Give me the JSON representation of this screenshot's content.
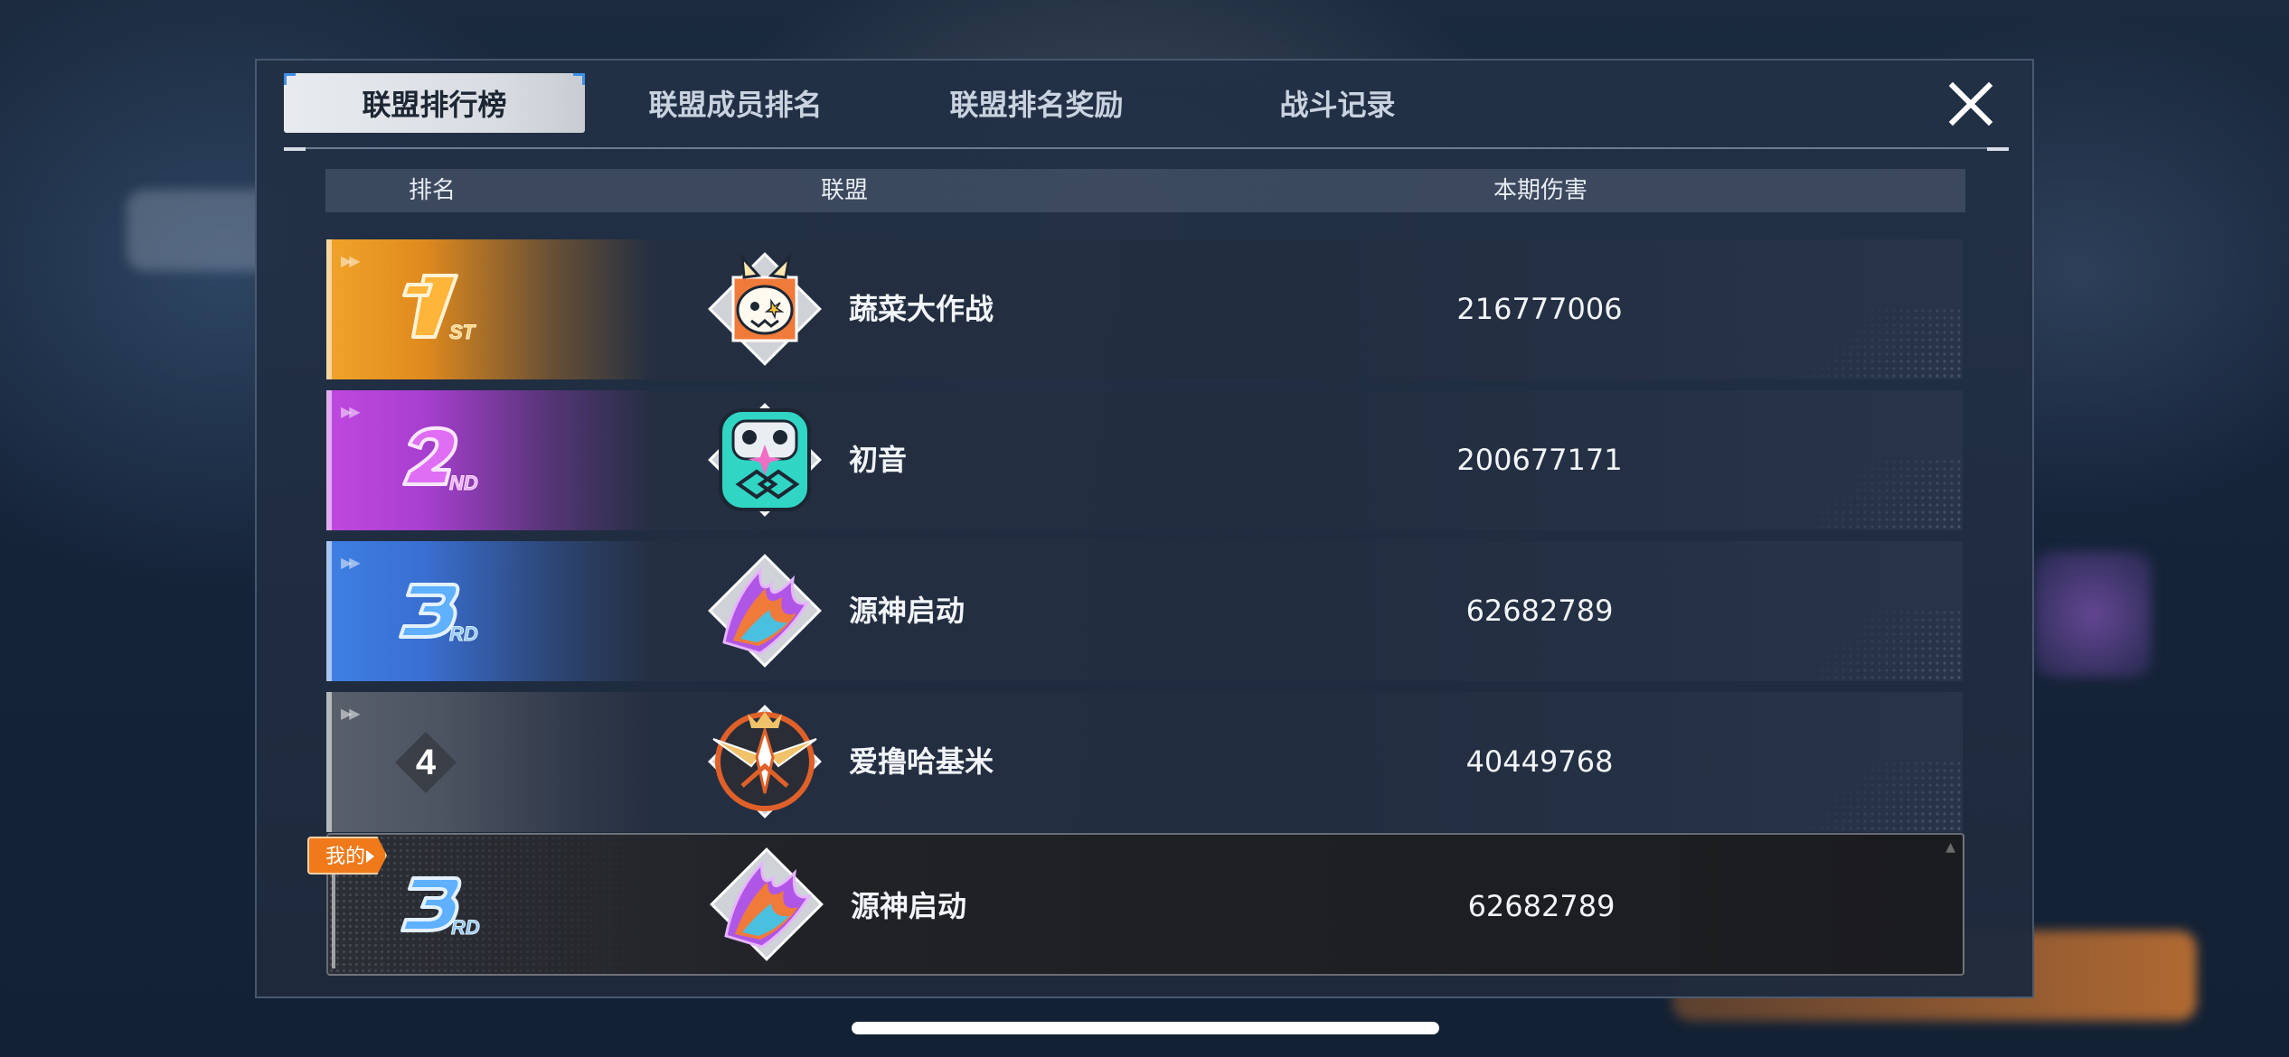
{
  "tabs": [
    {
      "label": "联盟排行榜",
      "active": true
    },
    {
      "label": "联盟成员排名",
      "active": false
    },
    {
      "label": "联盟排名奖励",
      "active": false
    },
    {
      "label": "战斗记录",
      "active": false
    }
  ],
  "columns": {
    "rank": "排名",
    "alliance": "联盟",
    "damage": "本期伤害"
  },
  "rows": [
    {
      "rank": 1,
      "rank_suffix": "ST",
      "rank_color": "#f0a42a",
      "name": "蔬菜大作战",
      "damage": "216777006",
      "emblem": "rabbit-emblem-icon"
    },
    {
      "rank": 2,
      "rank_suffix": "ND",
      "rank_color": "#c148e0",
      "name": "初音",
      "damage": "200677171",
      "emblem": "robot-emblem-icon"
    },
    {
      "rank": 3,
      "rank_suffix": "RD",
      "rank_color": "#3e7fe4",
      "name": "源神启动",
      "damage": "62682789",
      "emblem": "flame-emblem-icon"
    },
    {
      "rank": 4,
      "rank_label": "4",
      "rank_color": "#59606c",
      "name": "爱撸哈基米",
      "damage": "40449768",
      "emblem": "wings-emblem-icon"
    }
  ],
  "my_row": {
    "badge": "我的",
    "rank": 3,
    "rank_suffix": "RD",
    "name": "源神启动",
    "damage": "62682789",
    "emblem": "flame-emblem-icon"
  }
}
